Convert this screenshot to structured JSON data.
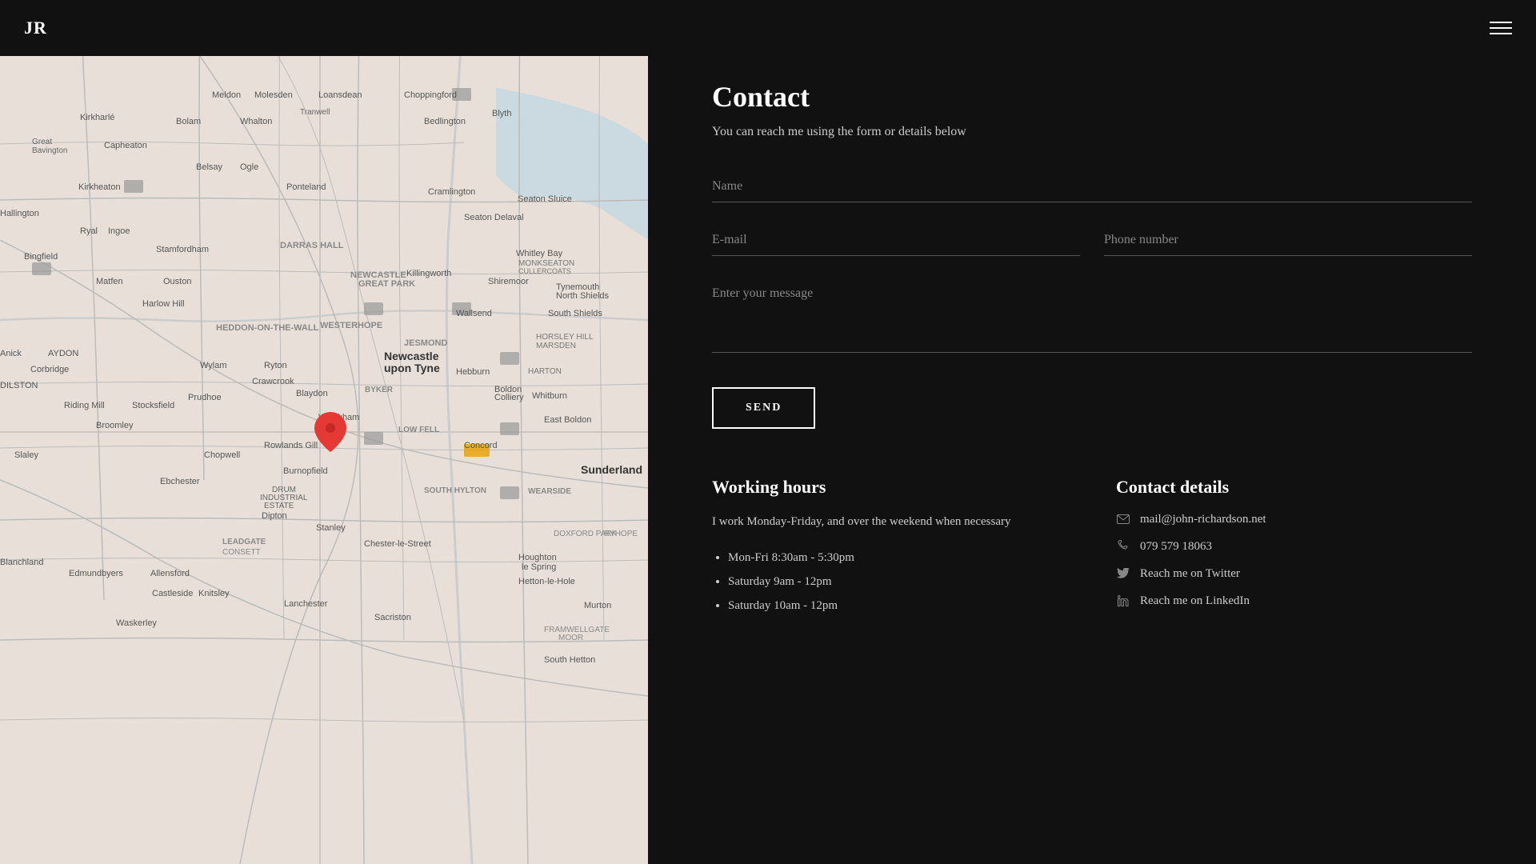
{
  "header": {
    "logo": "JR",
    "menu_icon": "hamburger"
  },
  "contact": {
    "title": "Contact",
    "subtitle": "You can reach me using the form or details below",
    "form": {
      "name_placeholder": "Name",
      "email_placeholder": "E-mail",
      "phone_placeholder": "Phone number",
      "message_placeholder": "Enter your message",
      "send_label": "SEND"
    },
    "working_hours": {
      "title": "Working hours",
      "description": "I work Monday-Friday, and over the weekend when necessary",
      "hours": [
        "Mon-Fri 8:30am - 5:30pm",
        "Saturday 9am - 12pm",
        "Saturday 10am - 12pm"
      ]
    },
    "contact_details": {
      "title": "Contact details",
      "email": "mail@john-richardson.net",
      "phone": "079 579 18063",
      "twitter": "Reach me on Twitter",
      "linkedin": "Reach me on LinkedIn"
    }
  },
  "map": {
    "location": "Newcastle upon Tyne area",
    "pin_label": "Location marker"
  }
}
